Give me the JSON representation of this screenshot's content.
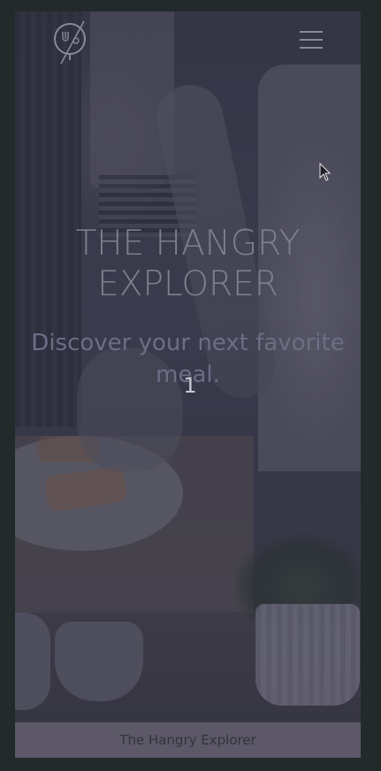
{
  "header": {
    "logo_icon": "fork-knife-compass-icon",
    "menu_icon": "hamburger-menu-icon"
  },
  "hero": {
    "title": "THE HANGRY EXPLORER",
    "subtitle": "Discover your next favorite meal.",
    "slide_number": "1"
  },
  "footer": {
    "text": "The Hangry Explorer"
  },
  "colors": {
    "page_background": "#232a2a",
    "overlay": "#3a3d4a",
    "footer_background": "#5c5868"
  }
}
